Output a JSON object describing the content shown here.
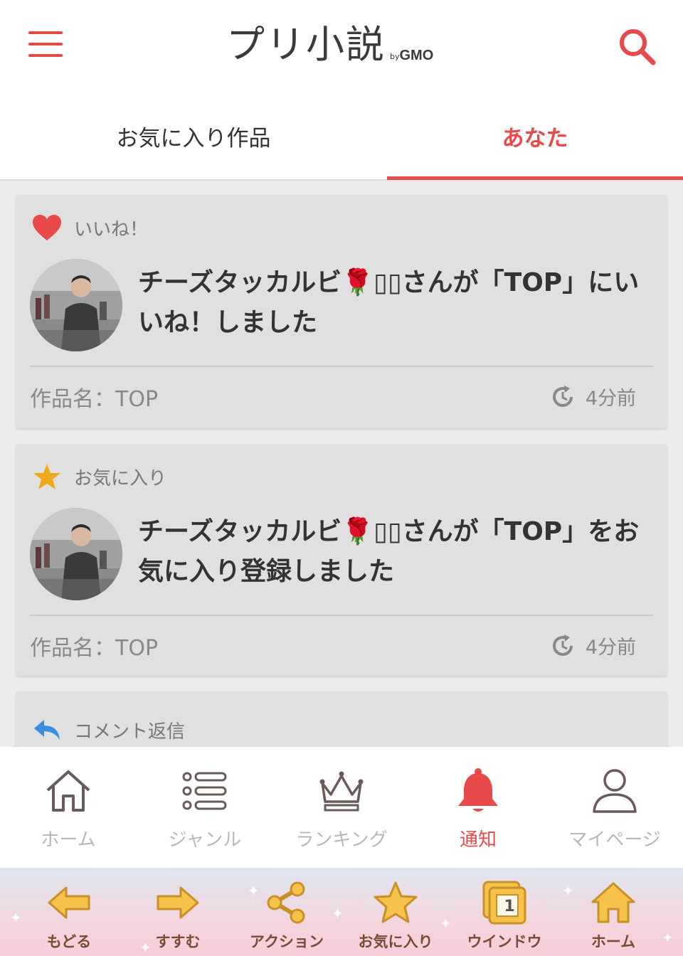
{
  "header": {
    "logo_main": "プリ小説",
    "logo_by": "by",
    "logo_gmo": "GMO"
  },
  "tabs": [
    {
      "label": "お気に入り作品",
      "active": false
    },
    {
      "label": "あなた",
      "active": true
    }
  ],
  "notifications": [
    {
      "type_label": "いいね！",
      "type_icon": "heart-icon",
      "message": "チーズタッカルビ🌹▯▯さんが「TOP」にいいね！しました",
      "work": "作品名：TOP",
      "time": "4分前"
    },
    {
      "type_label": "お気に入り",
      "type_icon": "star-icon",
      "message": "チーズタッカルビ🌹▯▯さんが「TOP」をお気に入り登録しました",
      "work": "作品名：TOP",
      "time": "4分前"
    },
    {
      "type_label": "コメント返信",
      "type_icon": "reply-icon"
    }
  ],
  "bottom_nav": [
    {
      "label": "ホーム",
      "icon": "home-icon",
      "active": false
    },
    {
      "label": "ジャンル",
      "icon": "list-icon",
      "active": false
    },
    {
      "label": "ランキング",
      "icon": "crown-icon",
      "active": false
    },
    {
      "label": "通知",
      "icon": "bell-icon",
      "active": true
    },
    {
      "label": "マイページ",
      "icon": "user-icon",
      "active": false
    }
  ],
  "browser_bar": [
    {
      "label": "もどる",
      "icon": "arrow-left-icon"
    },
    {
      "label": "すすむ",
      "icon": "arrow-right-icon"
    },
    {
      "label": "アクション",
      "icon": "share-icon"
    },
    {
      "label": "お気に入り",
      "icon": "star-icon"
    },
    {
      "label": "ウインドウ",
      "icon": "window-icon",
      "badge": "1"
    },
    {
      "label": "ホーム",
      "icon": "home-icon"
    }
  ],
  "colors": {
    "accent": "#e84a4a",
    "star": "#f0a81c",
    "reply": "#3a8ee0",
    "browser_icon": "#f7c24a"
  }
}
